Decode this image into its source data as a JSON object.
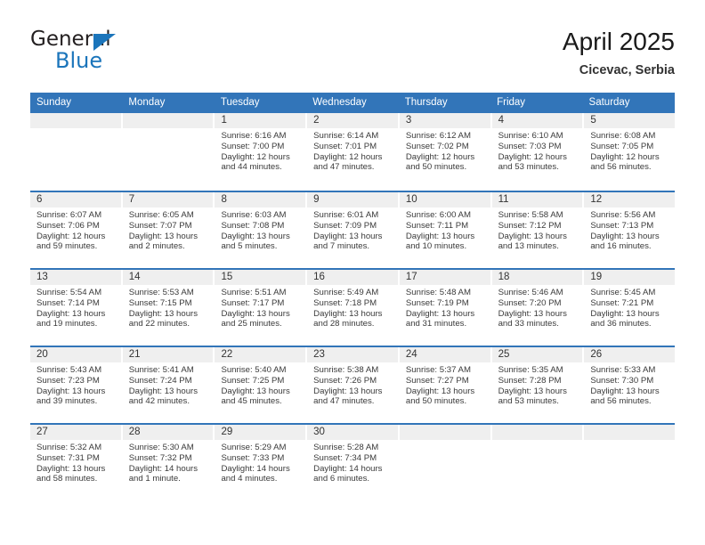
{
  "brand": {
    "name_top": "General",
    "name_bottom": "Blue",
    "accent_color": "#1b75bb"
  },
  "header": {
    "title": "April 2025",
    "subtitle": "Cicevac, Serbia"
  },
  "theme": {
    "header_blue": "#3275b9",
    "daynum_band": "#efefef",
    "text": "#3a3a3a"
  },
  "calendar": {
    "weekday_headers": [
      "Sunday",
      "Monday",
      "Tuesday",
      "Wednesday",
      "Thursday",
      "Friday",
      "Saturday"
    ],
    "weeks": [
      [
        {
          "day": "",
          "lines": []
        },
        {
          "day": "",
          "lines": []
        },
        {
          "day": "1",
          "lines": [
            "Sunrise: 6:16 AM",
            "Sunset: 7:00 PM",
            "Daylight: 12 hours",
            "and 44 minutes."
          ]
        },
        {
          "day": "2",
          "lines": [
            "Sunrise: 6:14 AM",
            "Sunset: 7:01 PM",
            "Daylight: 12 hours",
            "and 47 minutes."
          ]
        },
        {
          "day": "3",
          "lines": [
            "Sunrise: 6:12 AM",
            "Sunset: 7:02 PM",
            "Daylight: 12 hours",
            "and 50 minutes."
          ]
        },
        {
          "day": "4",
          "lines": [
            "Sunrise: 6:10 AM",
            "Sunset: 7:03 PM",
            "Daylight: 12 hours",
            "and 53 minutes."
          ]
        },
        {
          "day": "5",
          "lines": [
            "Sunrise: 6:08 AM",
            "Sunset: 7:05 PM",
            "Daylight: 12 hours",
            "and 56 minutes."
          ]
        }
      ],
      [
        {
          "day": "6",
          "lines": [
            "Sunrise: 6:07 AM",
            "Sunset: 7:06 PM",
            "Daylight: 12 hours",
            "and 59 minutes."
          ]
        },
        {
          "day": "7",
          "lines": [
            "Sunrise: 6:05 AM",
            "Sunset: 7:07 PM",
            "Daylight: 13 hours",
            "and 2 minutes."
          ]
        },
        {
          "day": "8",
          "lines": [
            "Sunrise: 6:03 AM",
            "Sunset: 7:08 PM",
            "Daylight: 13 hours",
            "and 5 minutes."
          ]
        },
        {
          "day": "9",
          "lines": [
            "Sunrise: 6:01 AM",
            "Sunset: 7:09 PM",
            "Daylight: 13 hours",
            "and 7 minutes."
          ]
        },
        {
          "day": "10",
          "lines": [
            "Sunrise: 6:00 AM",
            "Sunset: 7:11 PM",
            "Daylight: 13 hours",
            "and 10 minutes."
          ]
        },
        {
          "day": "11",
          "lines": [
            "Sunrise: 5:58 AM",
            "Sunset: 7:12 PM",
            "Daylight: 13 hours",
            "and 13 minutes."
          ]
        },
        {
          "day": "12",
          "lines": [
            "Sunrise: 5:56 AM",
            "Sunset: 7:13 PM",
            "Daylight: 13 hours",
            "and 16 minutes."
          ]
        }
      ],
      [
        {
          "day": "13",
          "lines": [
            "Sunrise: 5:54 AM",
            "Sunset: 7:14 PM",
            "Daylight: 13 hours",
            "and 19 minutes."
          ]
        },
        {
          "day": "14",
          "lines": [
            "Sunrise: 5:53 AM",
            "Sunset: 7:15 PM",
            "Daylight: 13 hours",
            "and 22 minutes."
          ]
        },
        {
          "day": "15",
          "lines": [
            "Sunrise: 5:51 AM",
            "Sunset: 7:17 PM",
            "Daylight: 13 hours",
            "and 25 minutes."
          ]
        },
        {
          "day": "16",
          "lines": [
            "Sunrise: 5:49 AM",
            "Sunset: 7:18 PM",
            "Daylight: 13 hours",
            "and 28 minutes."
          ]
        },
        {
          "day": "17",
          "lines": [
            "Sunrise: 5:48 AM",
            "Sunset: 7:19 PM",
            "Daylight: 13 hours",
            "and 31 minutes."
          ]
        },
        {
          "day": "18",
          "lines": [
            "Sunrise: 5:46 AM",
            "Sunset: 7:20 PM",
            "Daylight: 13 hours",
            "and 33 minutes."
          ]
        },
        {
          "day": "19",
          "lines": [
            "Sunrise: 5:45 AM",
            "Sunset: 7:21 PM",
            "Daylight: 13 hours",
            "and 36 minutes."
          ]
        }
      ],
      [
        {
          "day": "20",
          "lines": [
            "Sunrise: 5:43 AM",
            "Sunset: 7:23 PM",
            "Daylight: 13 hours",
            "and 39 minutes."
          ]
        },
        {
          "day": "21",
          "lines": [
            "Sunrise: 5:41 AM",
            "Sunset: 7:24 PM",
            "Daylight: 13 hours",
            "and 42 minutes."
          ]
        },
        {
          "day": "22",
          "lines": [
            "Sunrise: 5:40 AM",
            "Sunset: 7:25 PM",
            "Daylight: 13 hours",
            "and 45 minutes."
          ]
        },
        {
          "day": "23",
          "lines": [
            "Sunrise: 5:38 AM",
            "Sunset: 7:26 PM",
            "Daylight: 13 hours",
            "and 47 minutes."
          ]
        },
        {
          "day": "24",
          "lines": [
            "Sunrise: 5:37 AM",
            "Sunset: 7:27 PM",
            "Daylight: 13 hours",
            "and 50 minutes."
          ]
        },
        {
          "day": "25",
          "lines": [
            "Sunrise: 5:35 AM",
            "Sunset: 7:28 PM",
            "Daylight: 13 hours",
            "and 53 minutes."
          ]
        },
        {
          "day": "26",
          "lines": [
            "Sunrise: 5:33 AM",
            "Sunset: 7:30 PM",
            "Daylight: 13 hours",
            "and 56 minutes."
          ]
        }
      ],
      [
        {
          "day": "27",
          "lines": [
            "Sunrise: 5:32 AM",
            "Sunset: 7:31 PM",
            "Daylight: 13 hours",
            "and 58 minutes."
          ]
        },
        {
          "day": "28",
          "lines": [
            "Sunrise: 5:30 AM",
            "Sunset: 7:32 PM",
            "Daylight: 14 hours",
            "and 1 minute."
          ]
        },
        {
          "day": "29",
          "lines": [
            "Sunrise: 5:29 AM",
            "Sunset: 7:33 PM",
            "Daylight: 14 hours",
            "and 4 minutes."
          ]
        },
        {
          "day": "30",
          "lines": [
            "Sunrise: 5:28 AM",
            "Sunset: 7:34 PM",
            "Daylight: 14 hours",
            "and 6 minutes."
          ]
        },
        {
          "day": "",
          "lines": []
        },
        {
          "day": "",
          "lines": []
        },
        {
          "day": "",
          "lines": []
        }
      ]
    ]
  }
}
